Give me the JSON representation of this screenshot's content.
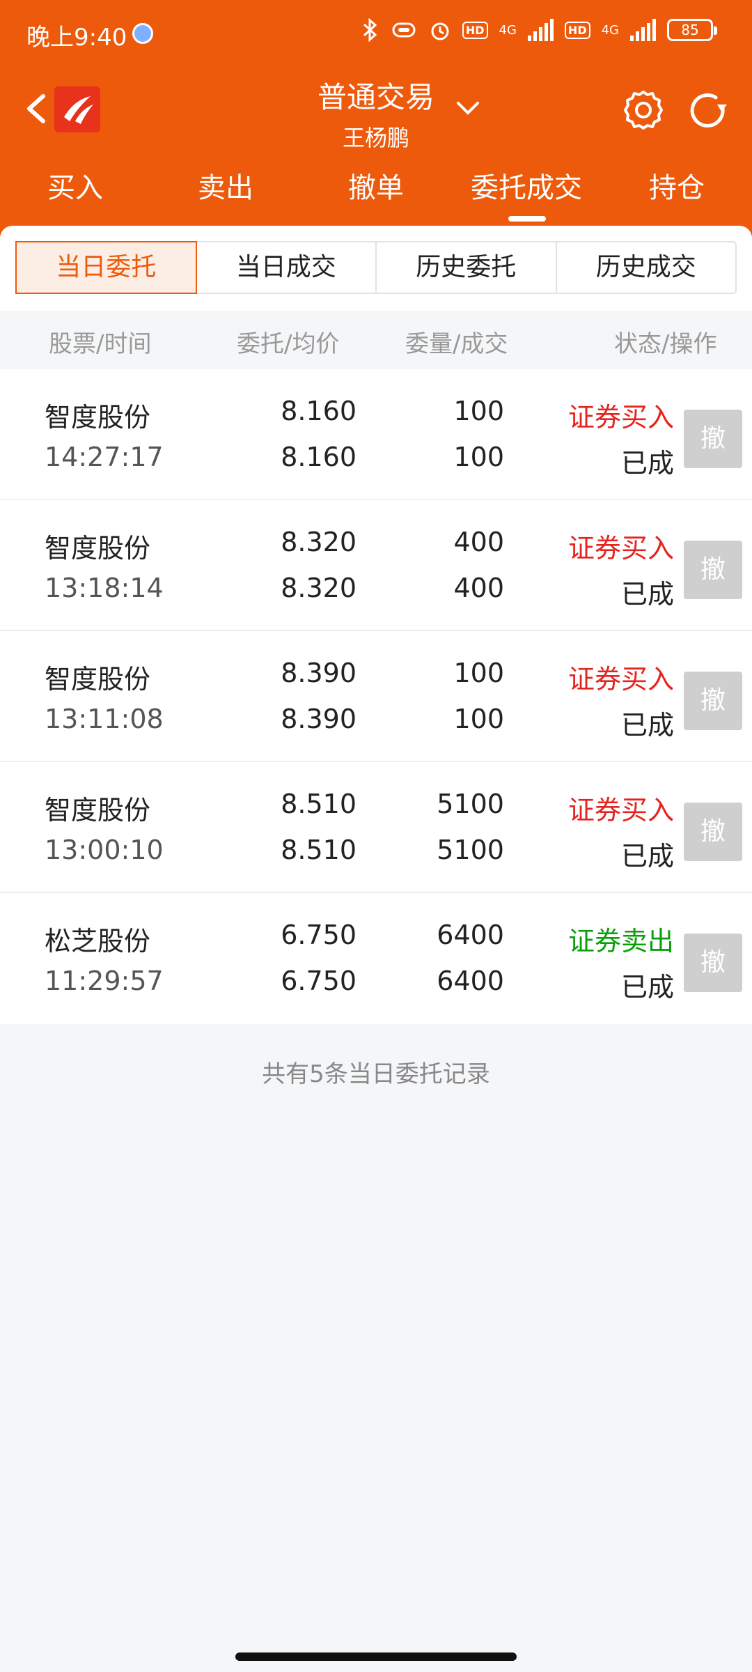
{
  "status_bar": {
    "time": "晚上9:40",
    "network": "4G",
    "hd": "HD",
    "battery": "85"
  },
  "header": {
    "title": "普通交易",
    "subtitle": "王杨鹏"
  },
  "tabs": [
    {
      "label": "买入"
    },
    {
      "label": "卖出"
    },
    {
      "label": "撤单"
    },
    {
      "label": "委托成交",
      "active": true
    },
    {
      "label": "持仓"
    }
  ],
  "segments": [
    {
      "label": "当日委托",
      "active": true
    },
    {
      "label": "当日成交"
    },
    {
      "label": "历史委托"
    },
    {
      "label": "历史成交"
    }
  ],
  "table": {
    "headers": [
      "股票/时间",
      "委托/均价",
      "委量/成交",
      "状态/操作"
    ],
    "rows": [
      {
        "name": "智度股份",
        "time": "14:27:17",
        "order_price": "8.160",
        "avg_price": "8.160",
        "order_qty": "100",
        "filled_qty": "100",
        "type": "证券买入",
        "state": "已成",
        "side": "buy",
        "action": "撤"
      },
      {
        "name": "智度股份",
        "time": "13:18:14",
        "order_price": "8.320",
        "avg_price": "8.320",
        "order_qty": "400",
        "filled_qty": "400",
        "type": "证券买入",
        "state": "已成",
        "side": "buy",
        "action": "撤"
      },
      {
        "name": "智度股份",
        "time": "13:11:08",
        "order_price": "8.390",
        "avg_price": "8.390",
        "order_qty": "100",
        "filled_qty": "100",
        "type": "证券买入",
        "state": "已成",
        "side": "buy",
        "action": "撤"
      },
      {
        "name": "智度股份",
        "time": "13:00:10",
        "order_price": "8.510",
        "avg_price": "8.510",
        "order_qty": "5100",
        "filled_qty": "5100",
        "type": "证券买入",
        "state": "已成",
        "side": "buy",
        "action": "撤"
      },
      {
        "name": "松芝股份",
        "time": "11:29:57",
        "order_price": "6.750",
        "avg_price": "6.750",
        "order_qty": "6400",
        "filled_qty": "6400",
        "type": "证券卖出",
        "state": "已成",
        "side": "sell",
        "action": "撤"
      }
    ]
  },
  "footer_text": "共有5条当日委托记录",
  "colors": {
    "brand": "#ed5a0b",
    "buy": "#e5231f",
    "sell": "#0aa00a",
    "cancel_bg": "#cfcfcf"
  }
}
